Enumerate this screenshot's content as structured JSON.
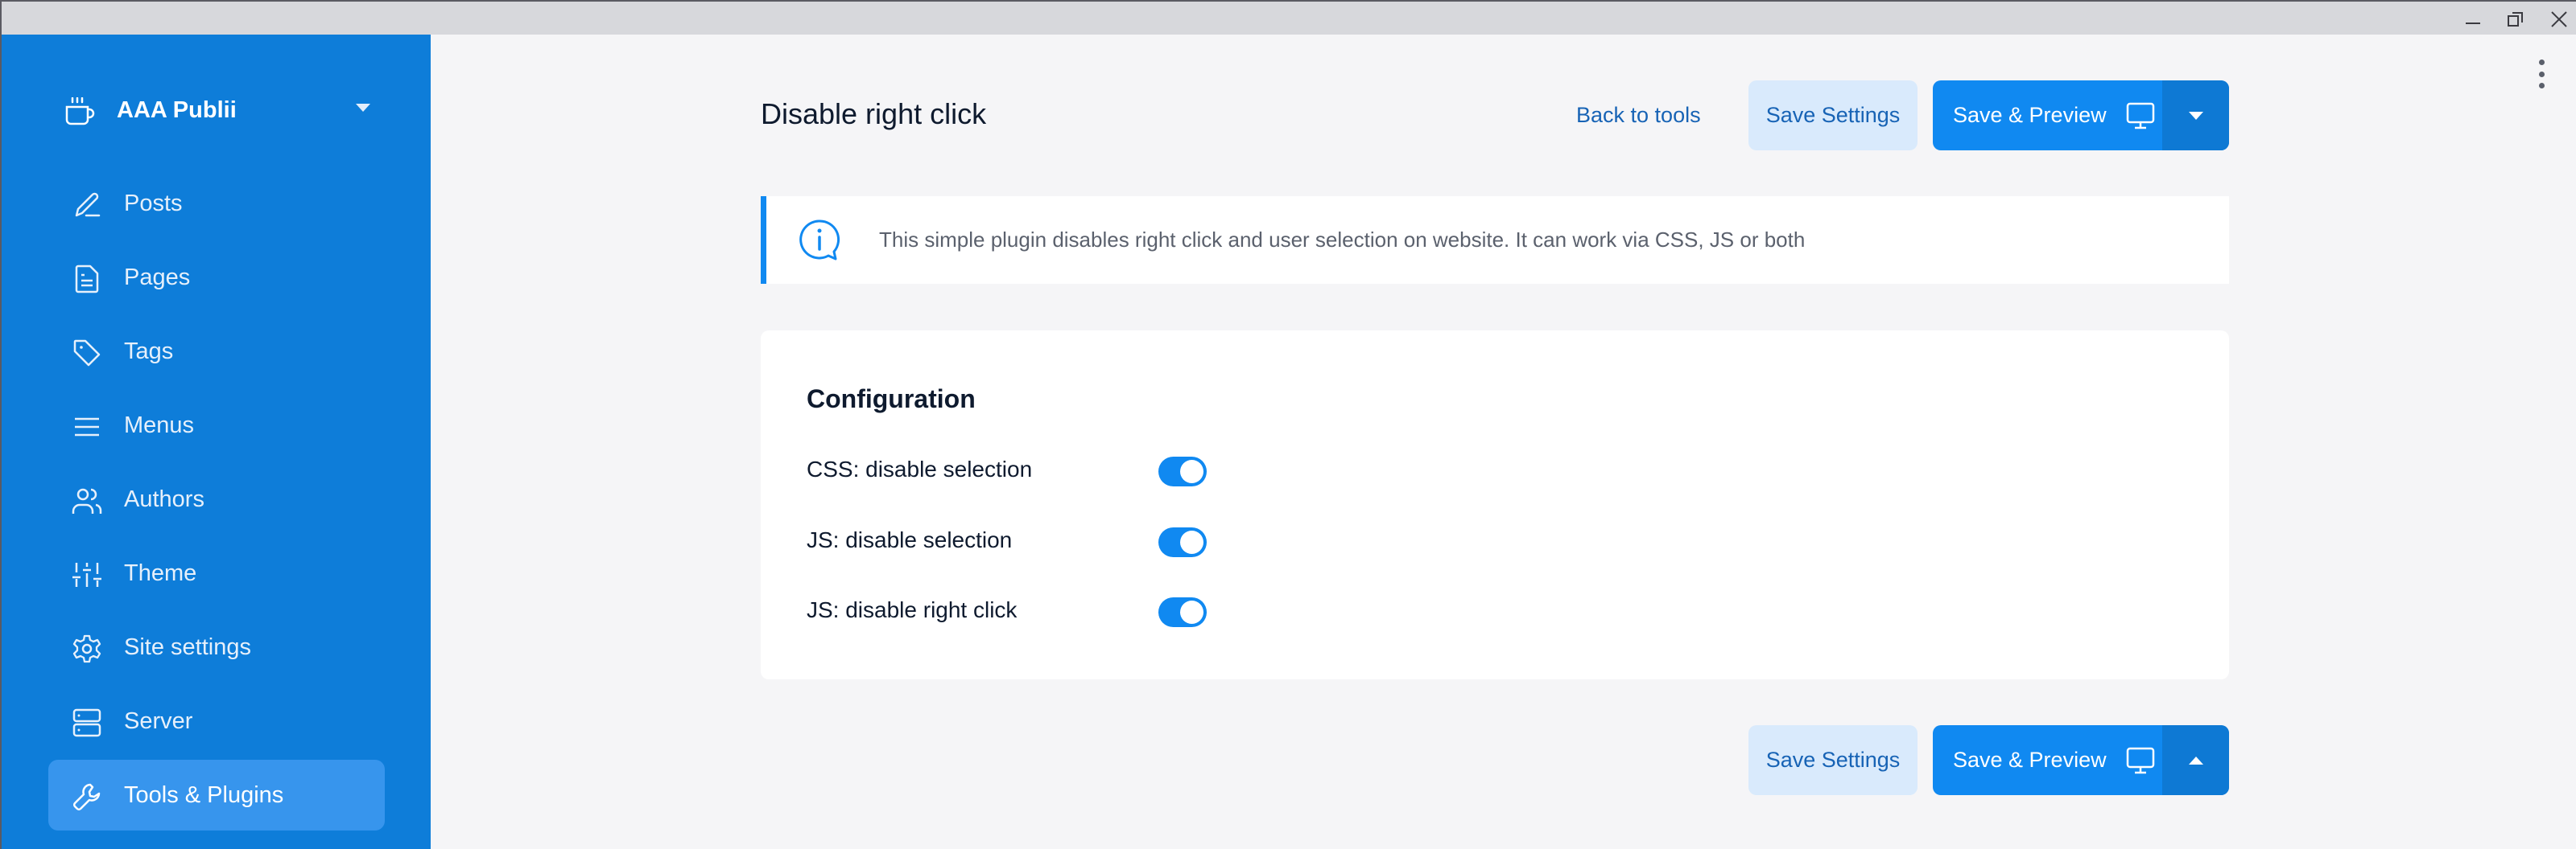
{
  "window": {
    "controls": [
      "minimize",
      "restore",
      "close"
    ]
  },
  "sidebar": {
    "site_name": "AAA Publii",
    "site_icon": "coffee-cup-icon",
    "items": [
      {
        "label": "Posts",
        "icon": "pencil-icon",
        "active": false
      },
      {
        "label": "Pages",
        "icon": "document-icon",
        "active": false
      },
      {
        "label": "Tags",
        "icon": "tag-icon",
        "active": false
      },
      {
        "label": "Menus",
        "icon": "menu-lines-icon",
        "active": false
      },
      {
        "label": "Authors",
        "icon": "users-icon",
        "active": false
      },
      {
        "label": "Theme",
        "icon": "sliders-icon",
        "active": false
      },
      {
        "label": "Site settings",
        "icon": "gear-icon",
        "active": false
      },
      {
        "label": "Server",
        "icon": "server-icon",
        "active": false
      },
      {
        "label": "Tools & Plugins",
        "icon": "wrench-icon",
        "active": true
      }
    ]
  },
  "header": {
    "title": "Disable right click",
    "back_link": "Back to tools",
    "save_settings": "Save Settings",
    "save_preview": "Save & Preview"
  },
  "info": {
    "text": "This simple plugin disables right click and user selection on website. It can work via CSS, JS or both"
  },
  "config": {
    "title": "Configuration",
    "options": [
      {
        "label": "CSS: disable selection",
        "enabled": true
      },
      {
        "label": "JS: disable selection",
        "enabled": true
      },
      {
        "label": "JS: disable right click",
        "enabled": true
      }
    ]
  },
  "footer": {
    "save_settings": "Save Settings",
    "save_preview": "Save & Preview"
  },
  "colors": {
    "sidebar_bg": "#0e7dd9",
    "sidebar_active": "#3795ed",
    "primary": "#1089f1",
    "primary_dark": "#0e79d4",
    "secondary_bg": "#d9eafc",
    "link": "#1763b5",
    "page_bg": "#f5f5f7"
  }
}
